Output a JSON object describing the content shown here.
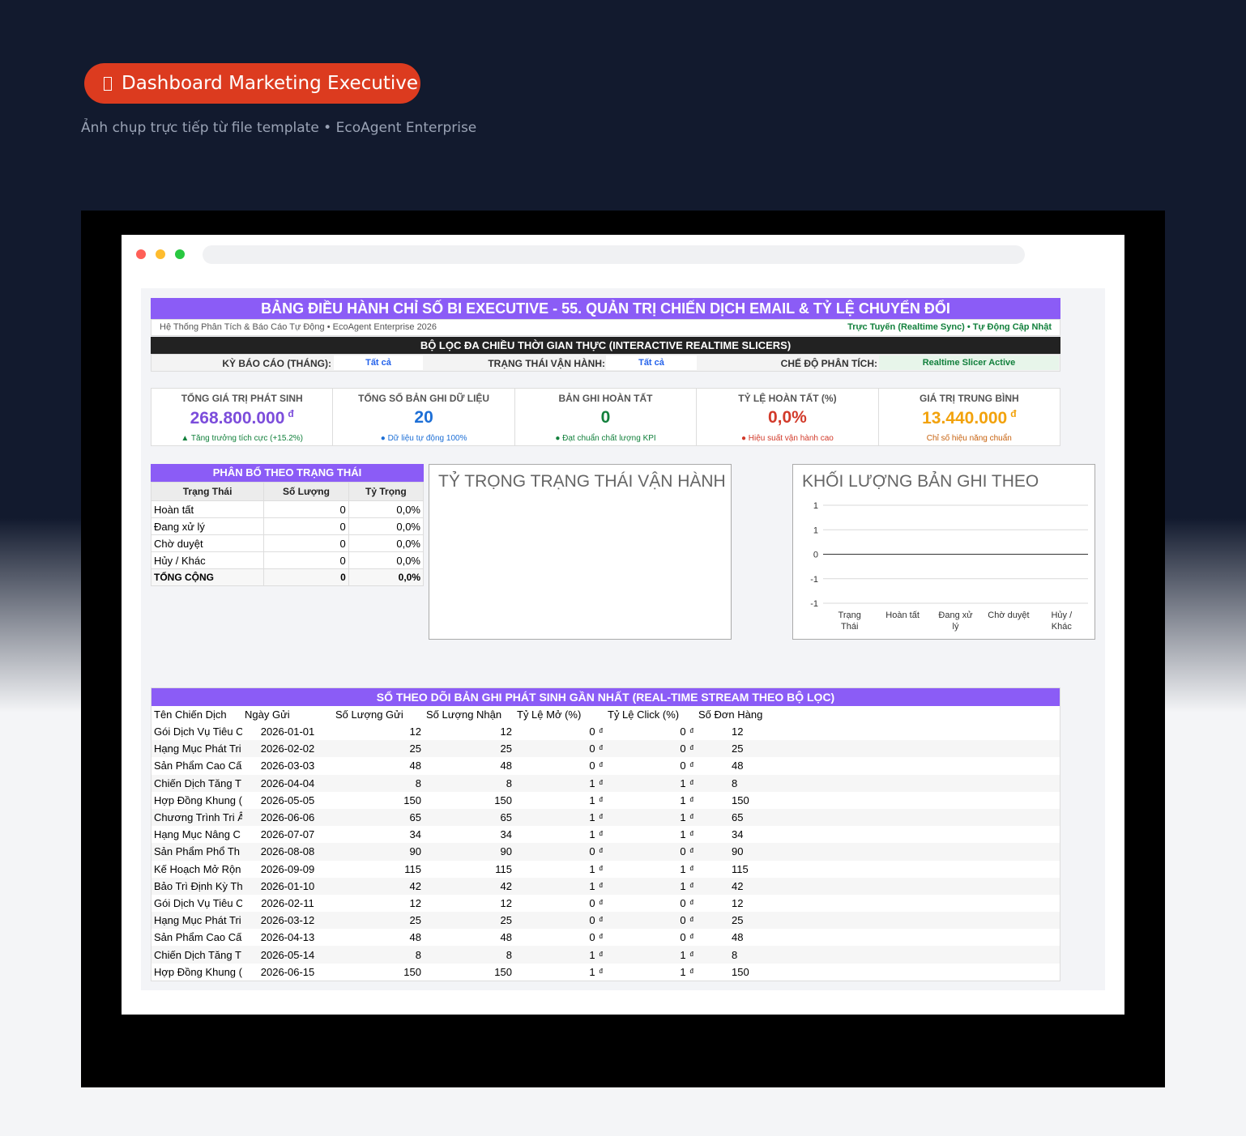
{
  "badge": {
    "label": "Dashboard Marketing Executive"
  },
  "subtitle": "Ảnh chụp trực tiếp từ file template • EcoAgent Enterprise",
  "dashboard": {
    "title": "BẢNG ĐIỀU HÀNH CHỈ SỐ BI EXECUTIVE - 55. QUẢN TRỊ CHIẾN DỊCH EMAIL & TỶ LỆ CHUYỂN ĐỔI",
    "system_label": "Hệ Thống Phân Tích & Báo Cáo Tự Động • EcoAgent Enterprise 2026",
    "status_label": "Trực Tuyến (Realtime Sync) • Tự Động Cập Nhật",
    "slicer_title": "BỘ LỌC ĐA CHIỀU THỜI GIAN THỰC (INTERACTIVE REALTIME SLICERS)",
    "filters": {
      "period_label": "KỲ BÁO CÁO (THÁNG):",
      "period_value": "Tất cả",
      "status_label": "TRẠNG THÁI VẬN HÀNH:",
      "status_value": "Tất cả",
      "mode_label": "CHẾ ĐỘ PHÂN TÍCH:",
      "mode_value": "Realtime Slicer Active"
    }
  },
  "kpis": [
    {
      "label": "TỔNG GIÁ TRỊ PHÁT SINH",
      "value": "268.800.000",
      "unit": "đ",
      "note": "▲ Tăng trưởng tích cực (+15.2%)",
      "color": "#7c4ddb",
      "note_color": "#12803c"
    },
    {
      "label": "TỔNG SỐ BẢN GHI DỮ LIỆU",
      "value": "20",
      "unit": "",
      "note": "● Dữ liệu tự động 100%",
      "color": "#1d6fd6",
      "note_color": "#1d6fd6"
    },
    {
      "label": "BẢN GHI HOÀN TẤT",
      "value": "0",
      "unit": "",
      "note": "● Đạt chuẩn chất lượng KPI",
      "color": "#12803c",
      "note_color": "#12803c"
    },
    {
      "label": "TỶ LỆ HOÀN TẤT (%)",
      "value": "0,0%",
      "unit": "",
      "note": "● Hiệu suất vận hành cao",
      "color": "#d23a2a",
      "note_color": "#d23a2a"
    },
    {
      "label": "GIÁ TRỊ TRUNG BÌNH",
      "value": "13.440.000",
      "unit": "đ",
      "note": "Chỉ số hiệu năng chuẩn",
      "color": "#f2a20c",
      "note_color": "#c7620f"
    }
  ],
  "status_table": {
    "title": "PHÂN BỔ THEO TRẠNG THÁI",
    "headers": [
      "Trạng Thái",
      "Số Lượng",
      "Tỷ Trọng"
    ],
    "rows": [
      [
        "Hoàn tất",
        "0",
        "0,0%"
      ],
      [
        "Đang xử lý",
        "0",
        "0,0%"
      ],
      [
        "Chờ duyệt",
        "0",
        "0,0%"
      ],
      [
        "Hủy / Khác",
        "0",
        "0,0%"
      ]
    ],
    "total": [
      "TỔNG CỘNG",
      "0",
      "0,0%"
    ]
  },
  "pie_chart": {
    "title": "TỶ TRỌNG TRẠNG THÁI VẬN HÀNH"
  },
  "chart_data": {
    "type": "bar",
    "title": "KHỐI LƯỢNG BẢN GHI THEO",
    "categories": [
      "Trạng Thái",
      "Hoàn tất",
      "Đang xử lý",
      "Chờ duyệt",
      "Hủy / Khác"
    ],
    "values": [
      0,
      0,
      0,
      0,
      0
    ],
    "y_ticks": [
      "1",
      "1",
      "0",
      "-1",
      "-1"
    ],
    "ylim": [
      -1,
      1
    ],
    "grid": true
  },
  "recent": {
    "title": "SỔ THEO DÕI BẢN GHI PHÁT SINH GẦN NHẤT (REAL-TIME STREAM THEO BỘ LỌC)",
    "headers": [
      "Tên Chiến Dịch",
      "Ngày Gửi",
      "Số Lượng Gửi",
      "Số Lượng Nhận",
      "Tỷ Lệ Mở (%)",
      "Tỷ Lệ Click (%)",
      "Số Đơn Hàng"
    ],
    "currency": "đ",
    "rows": [
      [
        "Gói Dịch Vụ Tiêu C",
        "2026-01-01",
        "12",
        "12",
        "0",
        "0",
        "12"
      ],
      [
        "Hạng Mục Phát Tri",
        "2026-02-02",
        "25",
        "25",
        "0",
        "0",
        "25"
      ],
      [
        "Sản Phẩm Cao Cấ",
        "2026-03-03",
        "48",
        "48",
        "0",
        "0",
        "48"
      ],
      [
        "Chiến Dịch Tăng T",
        "2026-04-04",
        "8",
        "8",
        "1",
        "1",
        "8"
      ],
      [
        "Hợp Đồng Khung (",
        "2026-05-05",
        "150",
        "150",
        "1",
        "1",
        "150"
      ],
      [
        "Chương Trình Tri Â",
        "2026-06-06",
        "65",
        "65",
        "1",
        "1",
        "65"
      ],
      [
        "Hạng Mục Nâng C",
        "2026-07-07",
        "34",
        "34",
        "1",
        "1",
        "34"
      ],
      [
        "Sản Phẩm Phổ Th",
        "2026-08-08",
        "90",
        "90",
        "0",
        "0",
        "90"
      ],
      [
        "Kế Hoạch Mở Rộn",
        "2026-09-09",
        "115",
        "115",
        "1",
        "1",
        "115"
      ],
      [
        "Bảo Trì Định Kỳ Th",
        "2026-01-10",
        "42",
        "42",
        "1",
        "1",
        "42"
      ],
      [
        "Gói Dịch Vụ Tiêu C",
        "2026-02-11",
        "12",
        "12",
        "0",
        "0",
        "12"
      ],
      [
        "Hạng Mục Phát Tri",
        "2026-03-12",
        "25",
        "25",
        "0",
        "0",
        "25"
      ],
      [
        "Sản Phẩm Cao Cấ",
        "2026-04-13",
        "48",
        "48",
        "0",
        "0",
        "48"
      ],
      [
        "Chiến Dịch Tăng T",
        "2026-05-14",
        "8",
        "8",
        "1",
        "1",
        "8"
      ],
      [
        "Hợp Đồng Khung (",
        "2026-06-15",
        "150",
        "150",
        "1",
        "1",
        "150"
      ]
    ]
  },
  "colors": {
    "accent": "#8b5cf6",
    "badge": "#dc3b1f",
    "background": "#121a2e"
  }
}
